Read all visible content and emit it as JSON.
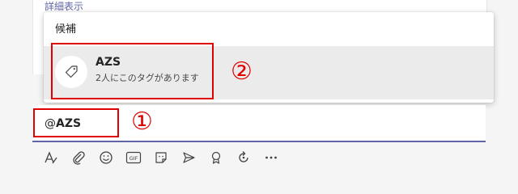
{
  "message": {
    "detail_link": "詳細表示"
  },
  "suggestions": {
    "header": "候補",
    "items": [
      {
        "name": "AZS",
        "description": "2人にこのタグがあります",
        "icon": "tag-icon"
      }
    ]
  },
  "compose": {
    "at_sign": "@",
    "mention": "AZS"
  },
  "annotations": {
    "marker_1": "①",
    "marker_2": "②",
    "color": "#e00000"
  },
  "toolbar": {
    "buttons": [
      {
        "name": "format",
        "icon": "format-text-icon"
      },
      {
        "name": "attach",
        "icon": "paperclip-icon"
      },
      {
        "name": "emoji",
        "icon": "emoji-icon"
      },
      {
        "name": "gif",
        "icon": "gif-icon",
        "label": "GIF"
      },
      {
        "name": "sticker",
        "icon": "sticker-icon"
      },
      {
        "name": "meet",
        "icon": "meet-now-icon"
      },
      {
        "name": "praise",
        "icon": "praise-icon"
      },
      {
        "name": "loop",
        "icon": "loop-icon"
      },
      {
        "name": "more",
        "icon": "more-options-icon"
      }
    ]
  },
  "colors": {
    "accent": "#6264a7",
    "annotation": "#e00000",
    "selected_row": "#ebebeb"
  }
}
